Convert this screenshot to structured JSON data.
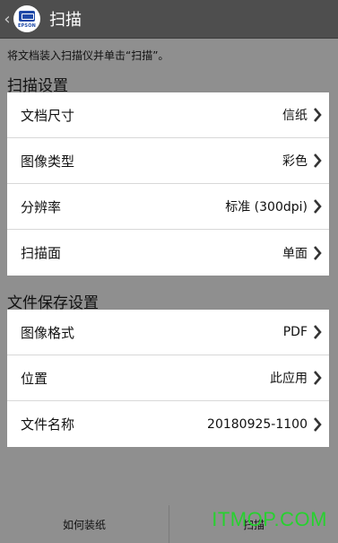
{
  "app": {
    "title": "扫描",
    "brand": "EPSON"
  },
  "hint": "将文档装入扫描仪并单击“扫描”。",
  "scan_settings": {
    "title": "扫描设置",
    "rows": [
      {
        "label": "文档尺寸",
        "value": "信纸"
      },
      {
        "label": "图像类型",
        "value": "彩色"
      },
      {
        "label": "分辨率",
        "value": "标准 (300dpi)"
      },
      {
        "label": "扫描面",
        "value": "单面"
      }
    ]
  },
  "save_settings": {
    "title": "文件保存设置",
    "rows": [
      {
        "label": "图像格式",
        "value": "PDF"
      },
      {
        "label": "位置",
        "value": "此应用"
      },
      {
        "label": "文件名称",
        "value": "20180925-1100"
      }
    ]
  },
  "bottom": {
    "load_paper": "如何装纸",
    "scan": "扫描"
  },
  "watermark": "ITMOP.COM",
  "colors": {
    "appbar": "#4e4e4e",
    "background": "#8f8f8f",
    "watermark": "#27d12f"
  }
}
